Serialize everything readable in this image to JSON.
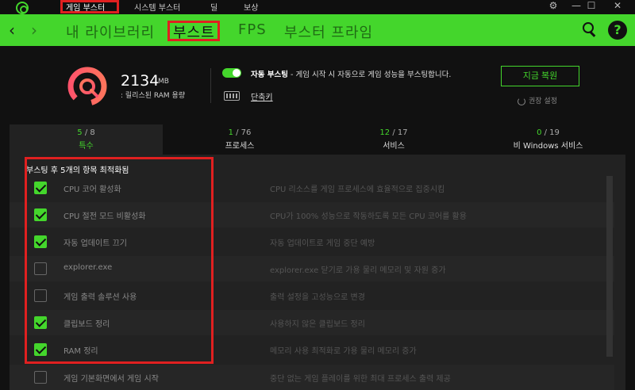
{
  "titlebar": {
    "tabs": [
      "게임 부스터",
      "시스템 부스터",
      "딜",
      "보상"
    ],
    "controls": [
      "gear-icon",
      "minimize-icon",
      "maximize-icon",
      "close-icon"
    ],
    "control_glyphs": [
      "⚙",
      "—",
      "☐",
      "✕"
    ]
  },
  "nav": {
    "back": "‹",
    "forward": "›",
    "tabs": [
      "내 라이브러리",
      "부스트",
      "FPS",
      "부스터 프라임"
    ],
    "active_tab": "부스트",
    "help": "?"
  },
  "summary": {
    "ram_value": "2134",
    "ram_unit": "MB",
    "ram_label": ": 릴리스된 RAM 용량",
    "auto_boost_title": "자동 부스팅",
    "auto_boost_desc": " - 게임 시작 시 자동으로 게임 성능을 부스팅합니다.",
    "auto_boost_enabled": true,
    "shortcut": "단축키",
    "restore_button": "지금 복원",
    "recommended": "권장 설정"
  },
  "stats": [
    {
      "count": "5",
      "total": " / 8",
      "label": "특수",
      "active": true
    },
    {
      "count": "1",
      "total": " / 76",
      "label": "프로세스",
      "active": false
    },
    {
      "count": "12",
      "total": " / 17",
      "label": "서비스",
      "active": false
    },
    {
      "count": "0",
      "total": " / 19",
      "label": "비 Windows 서비스",
      "active": false
    }
  ],
  "list": {
    "title": "부스팅 후 5개의 항목 최적화됨",
    "items": [
      {
        "name": "CPU 코어 활성화",
        "desc": "CPU 리소스를 게임 프로세스에 효율적으로 집중시킴",
        "checked": true
      },
      {
        "name": "CPU 절전 모드 비활성화",
        "desc": "CPU가 100% 성능으로 작동하도록 모든 CPU 코어를 활용",
        "checked": true
      },
      {
        "name": "자동 업데이트 끄기",
        "desc": "자동 업데이트로 게임 중단 예방",
        "checked": true
      },
      {
        "name": "explorer.exe",
        "desc": "explorer.exe 닫기로 가용 물리 메모리 및 자원 증가",
        "checked": false
      },
      {
        "name": "게임 출력 솔루션 사용",
        "desc": "출력 설정을 고성능으로 변경",
        "checked": false
      },
      {
        "name": "클립보드 정리",
        "desc": "사용하지 않은 클립보드 정리",
        "checked": true
      },
      {
        "name": "RAM 정리",
        "desc": "메모리 사용 최적화로 가용 물리 메모리 증가",
        "checked": true
      },
      {
        "name": "게임 기본화면에서 게임 시작",
        "desc": "중단 없는 게임 플레이를 위한 최대 프로세스 출력 제공",
        "checked": false
      }
    ]
  },
  "colors": {
    "accent": "#44d62c",
    "annotation": "#e02020",
    "bg": "#111111",
    "panel": "#222222"
  }
}
